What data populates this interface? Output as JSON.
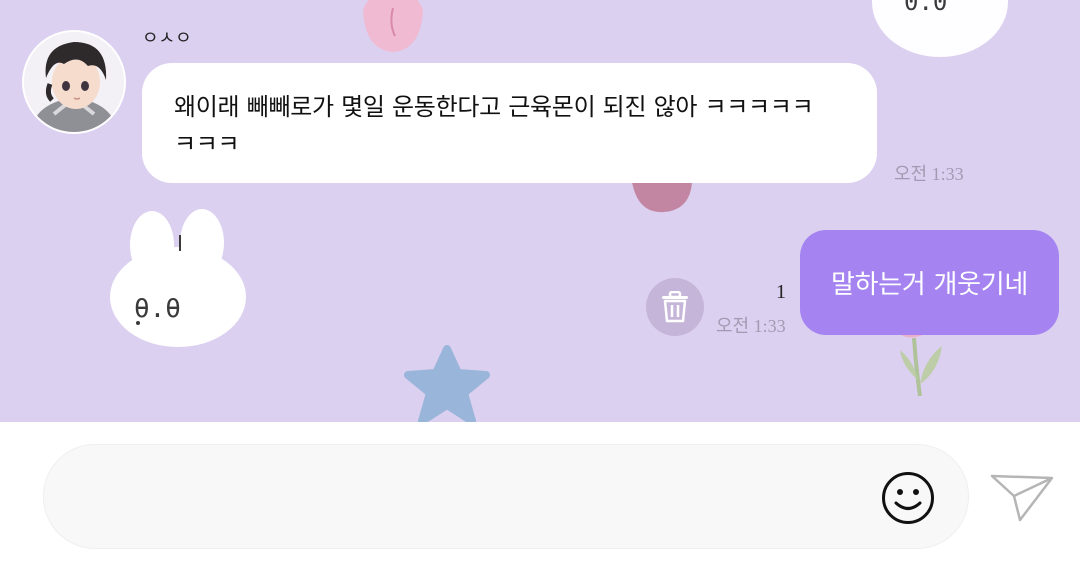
{
  "chat": {
    "sender_name": "ㅇㅅㅇ",
    "incoming": {
      "line1": "왜이래 빼빼로가 몇일 운동한다고 근육몬이 되진 않아 ㅋㅋㅋㅋㅋ",
      "line2": "ㅋㅋㅋ",
      "time": "오전 1:33"
    },
    "outgoing": {
      "text": "말하는거 개웃기네",
      "time": "오전 1:33",
      "unread_count": "1"
    }
  },
  "composer": {
    "value": "",
    "placeholder": ""
  },
  "icons": {
    "delete": "trash-icon",
    "emoji": "smiley-icon",
    "send": "paper-plane-icon"
  },
  "colors": {
    "chat_background": "#dcd0f0",
    "outgoing_bubble": "#a584f1",
    "incoming_bubble": "#ffffff",
    "timestamp": "#a19ab1",
    "delete_button": "#c5b5d9"
  }
}
